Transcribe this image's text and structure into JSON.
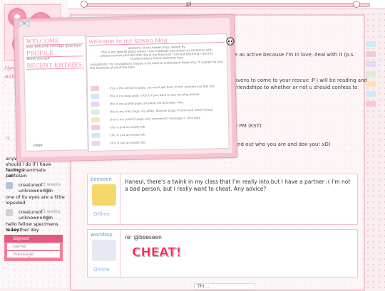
{
  "topbar": {
    "tab_label": "pl"
  },
  "sidebar": {
    "blurb": "Heve a of ou or e aste... All entre on .",
    "rc_label": "rc",
    "chats": [
      {
        "text": "anyway thought"
      },
      {
        "text": "should i do if i have feelings"
      },
      {
        "text": "for my inanimate porcelain"
      },
      {
        "text": "cat?"
      }
    ],
    "chat2": {
      "name": "creatureof",
      "meta": "3 weeks ago",
      "sub": "unknownorigin",
      "text1": "one of its eyes are a little",
      "text2": "lopsided"
    },
    "chat3": {
      "name": "creatureof",
      "meta": "3 weeks ago",
      "sub": "unknownorigin",
      "text1": "hello fellow specimens today",
      "text2": "is another day"
    },
    "messages": {
      "header": "Signed",
      "name_placeholder": "name",
      "message_placeholder": "message"
    }
  },
  "feed": {
    "bg_lines": [
      "me as active because i'm in love, deal with it (p.s.",
      "heavens to come to your rescue :P i will be reading and",
      "to friendships to whether or not u should confess to",
      ":59 PM (KST)",
      "u find out who you are and dox you! xD)"
    ],
    "posts": [
      {
        "username": "beeseen",
        "status": "Offline",
        "text": "Haneul, there's a twink in my class that I'm really into but I have a partner :( I'm not a bad person, but I really want to cheat. Any advice?"
      },
      {
        "username": "worldtop",
        "status": "Online",
        "reply_to": "re: @beeseen",
        "sticker": "CHEAT!"
      }
    ],
    "footer": "Thi ..."
  },
  "overlay": {
    "welcome_title": "WELCOME",
    "welcome_sub": "your welcome message goes here",
    "profile_title": "PROFILE",
    "profile_sub": "about yourself",
    "recent_title": "RECENT ENTRIES",
    "blog_title": "welcome to my kawaii blog",
    "intro1": "welcome to my kawaii blog. owned by",
    "intro2": "this is my special place where i can meditate and share my emotions with",
    "intro3": "please remind yourself that this is my blog and i can put anything i want to",
    "intro4": "troublemakers aren't welcome here",
    "notice": "navigations: my navigations maybe a bit hard to understand thats why i'll explain to you the locations of all of the tabs",
    "entries": [
      "- this is the welcome page, you can't get back to this anytime you feel lost",
      "- this is my blog page, click it if you want to see my blog entries",
      "- this is my profile page, all about me and what i like",
      "- this is my links page, my affies, favorite blogs, friends and sister's blogs",
      "- this is my contact page, any comments? messages?, click here",
      "- this is just an empty tab",
      "- this is just an empty tab",
      "- this is just an empty tab"
    ],
    "close_label": "close"
  },
  "colors": {
    "pink": "#f28fac",
    "light_pink": "#fbe3e9",
    "blue": "#6b8fd0"
  }
}
